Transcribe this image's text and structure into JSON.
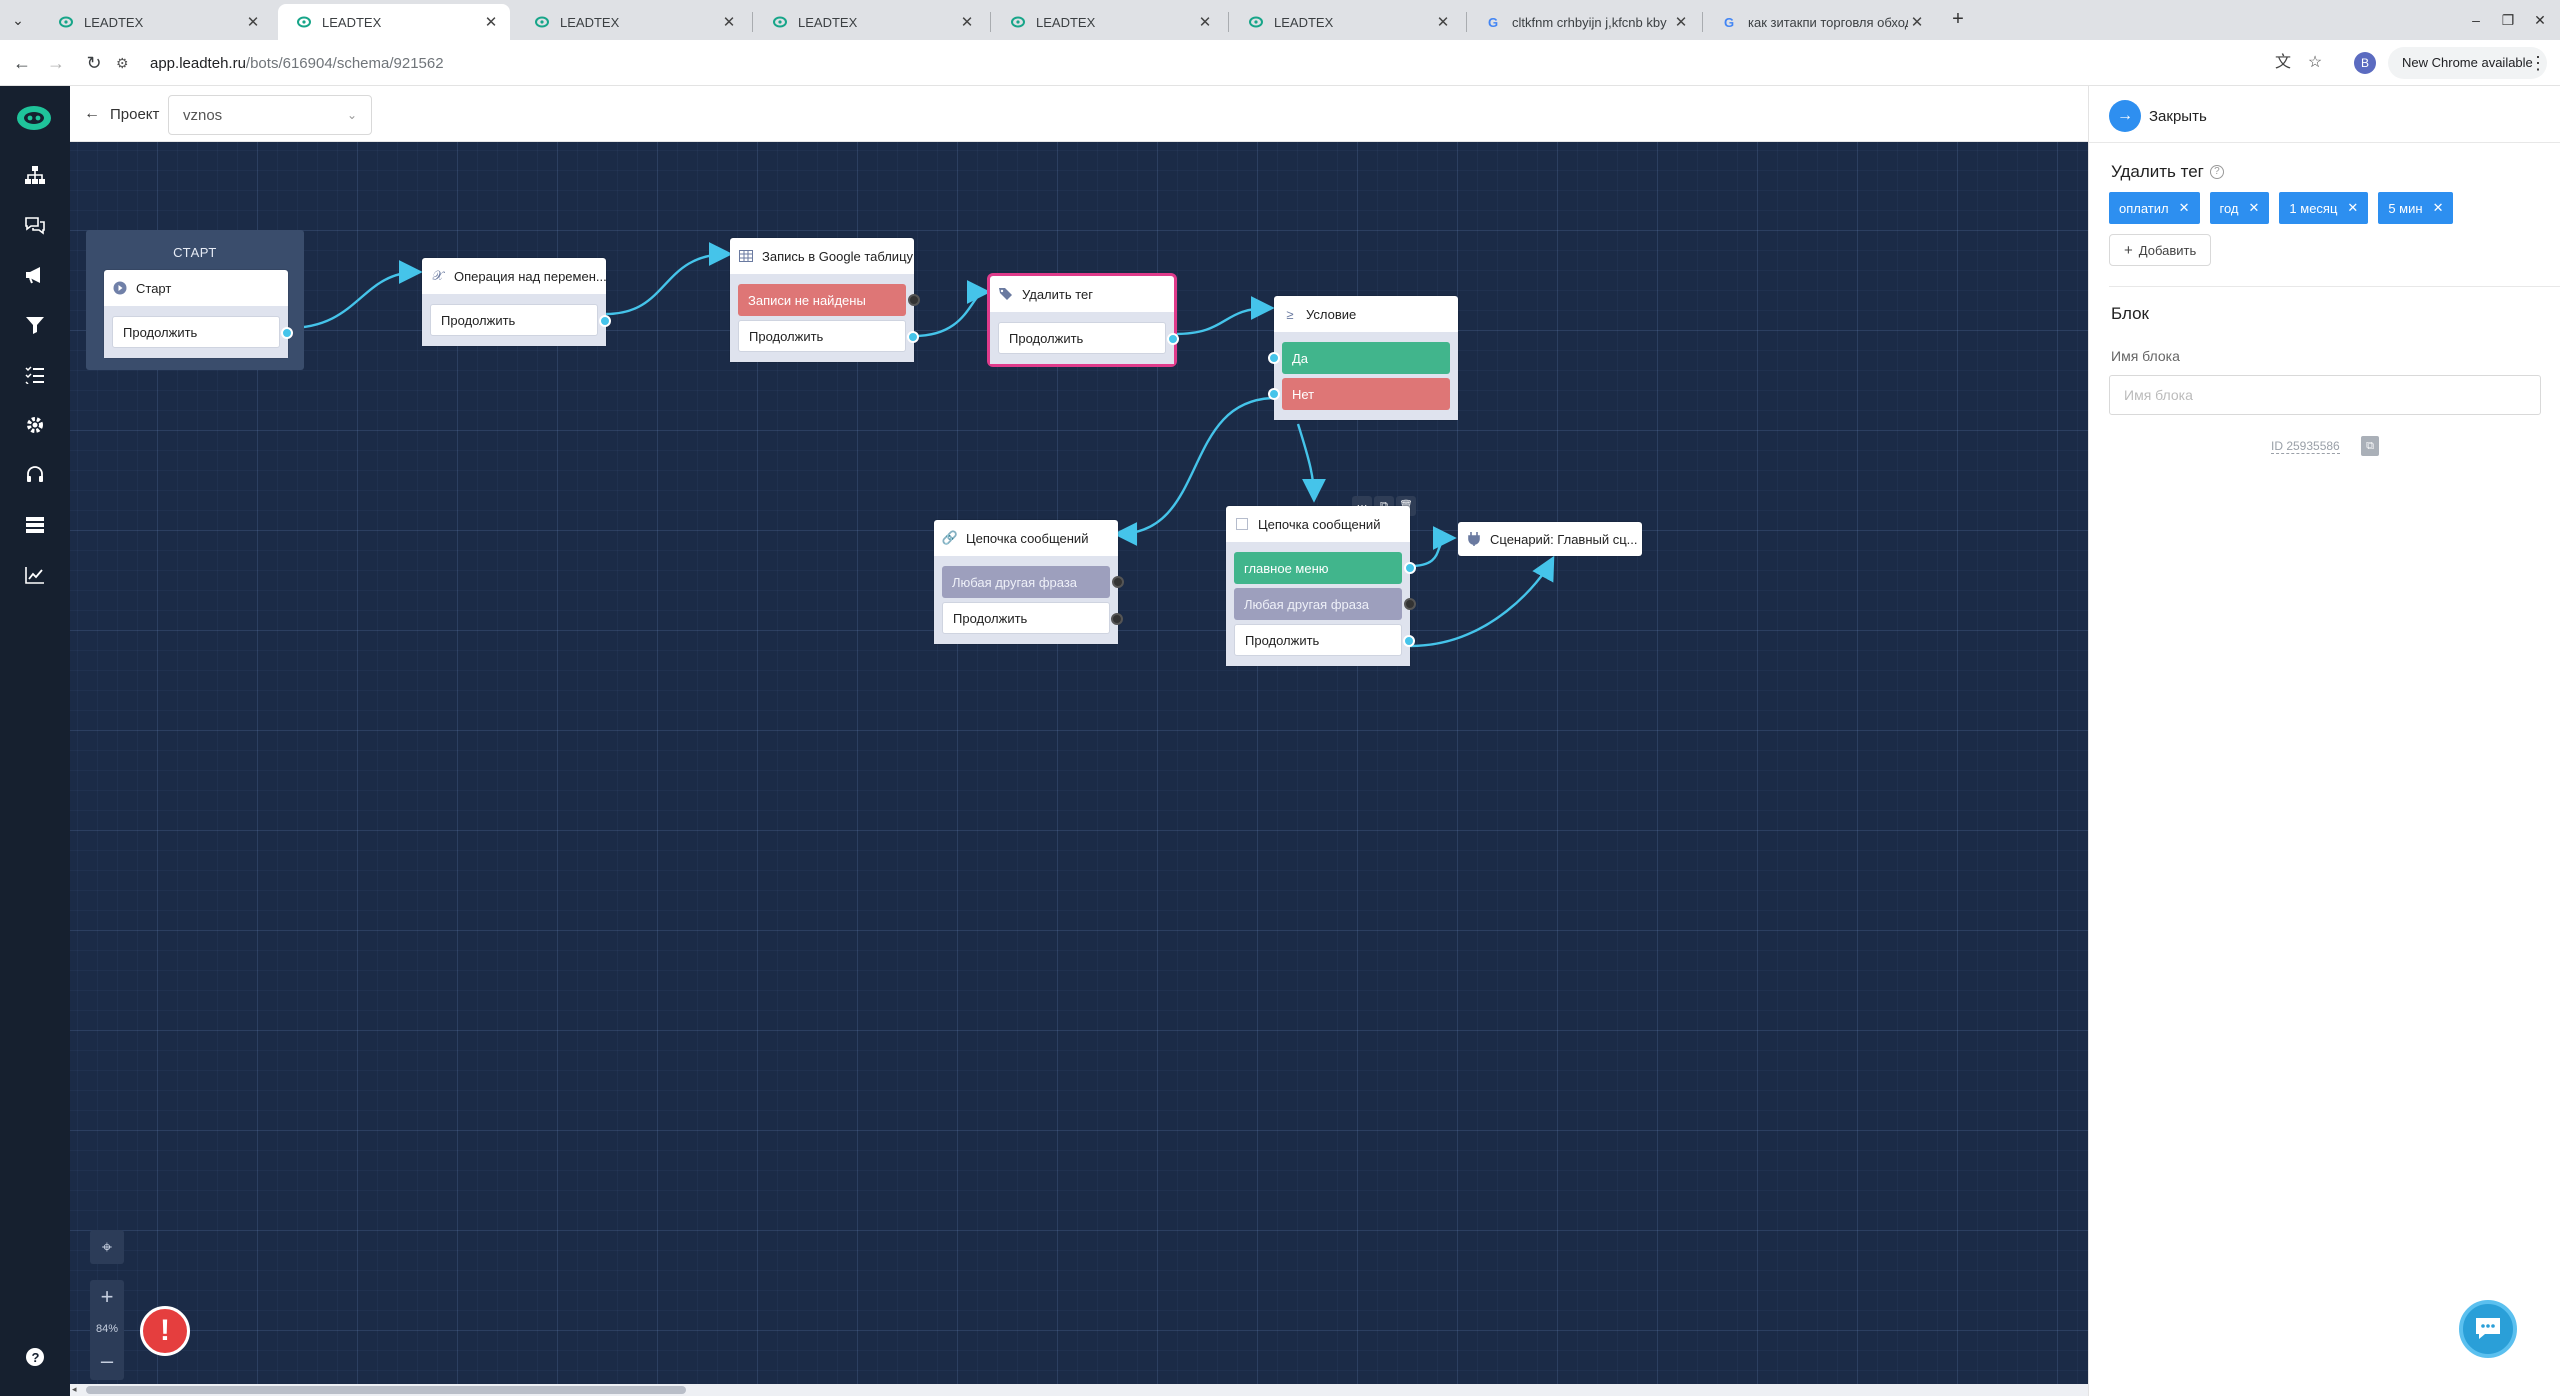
{
  "browser": {
    "tabs": [
      {
        "title": "LEADTEX",
        "icon": "leadtex-favicon",
        "active": false
      },
      {
        "title": "LEADTEX",
        "icon": "leadtex-favicon",
        "active": true
      },
      {
        "title": "LEADTEX",
        "icon": "leadtex-favicon",
        "active": false
      },
      {
        "title": "LEADTEX",
        "icon": "leadtex-favicon",
        "active": false
      },
      {
        "title": "LEADTEX",
        "icon": "leadtex-favicon",
        "active": false
      },
      {
        "title": "LEADTEX",
        "icon": "leadtex-favicon",
        "active": false
      },
      {
        "title": "cltkfnm crhbyijn j,kfcnb kby",
        "icon": "google-favicon",
        "active": false
      },
      {
        "title": "как зитакпи торговля обход",
        "icon": "google-favicon",
        "active": false
      }
    ],
    "url_host": "app.leadteh.ru",
    "url_path": "/bots/616904/schema/921562",
    "profile_initial": "B",
    "update_label": "New Chrome available"
  },
  "header": {
    "back_label": "Проект",
    "project_value": "vznos"
  },
  "canvas": {
    "start_caption": "СТАРТ",
    "nodes": {
      "start": {
        "title": "Старт",
        "btn": "Продолжить"
      },
      "operation": {
        "title": "Операция над перемен...",
        "btn": "Продолжить"
      },
      "gsheet": {
        "title": "Запись в Google таблицу",
        "btn_fail": "Записи не найдены",
        "btn": "Продолжить"
      },
      "delete_tag": {
        "title": "Удалить тег",
        "btn": "Продолжить"
      },
      "condition": {
        "title": "Условие",
        "yes": "Да",
        "no": "Нет"
      },
      "chain_left": {
        "title": "Цепочка сообщений",
        "any": "Любая другая фраза",
        "btn": "Продолжить"
      },
      "chain_right": {
        "title": "Цепочка сообщений",
        "menu": "главное меню",
        "any": "Любая другая фраза",
        "btn": "Продолжить"
      },
      "scenario": {
        "title": "Сценарий: Главный сц..."
      }
    },
    "zoom_level": "84%"
  },
  "panel": {
    "close_label": "Закрыть",
    "section_title": "Удалить тег",
    "tags": [
      "оплатил",
      "год",
      "1 месяц",
      "5 мин"
    ],
    "add_label": "Добавить",
    "block_title": "Блок",
    "name_label": "Имя блока",
    "name_placeholder": "Имя блока",
    "block_id": "ID 25935586"
  },
  "colors": {
    "canvas_bg": "#1b2b47",
    "rail_bg": "#16202f",
    "accent_blue": "#2d8ff0",
    "edge": "#45c4ea",
    "btn_red": "#de7676",
    "btn_green": "#41b58c",
    "selected_border": "#e03b8b"
  }
}
